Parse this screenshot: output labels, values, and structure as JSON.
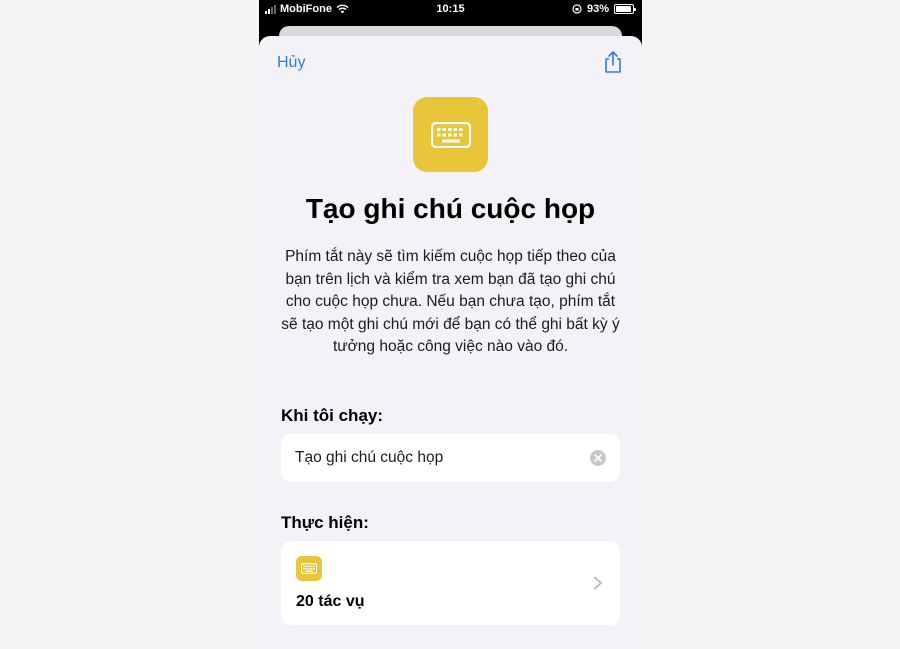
{
  "status_bar": {
    "carrier": "MobiFone",
    "time": "10:15",
    "battery": "93%",
    "battery_level": 0.93
  },
  "nav": {
    "cancel_label": "Hủy",
    "share_icon": "share-icon"
  },
  "shortcut": {
    "icon": "keyboard-icon",
    "icon_color": "#e9c53a",
    "title": "Tạo ghi chú cuộc họp",
    "description": "Phím tắt này sẽ tìm kiếm cuộc họp tiếp theo của bạn trên lịch và kiểm tra xem bạn đã tạo ghi chú cho cuộc họp chưa. Nếu bạn chưa tạo, phím tắt sẽ tạo một ghi chú mới để bạn có thể ghi bất kỳ ý tưởng hoặc công việc nào vào đó."
  },
  "run_section": {
    "label": "Khi tôi chạy:",
    "name_value": "Tạo ghi chú cuộc họp"
  },
  "do_section": {
    "label": "Thực hiện:",
    "actions_count": "20 tác vụ"
  },
  "colors": {
    "accent": "#3478f6",
    "sheet_bg": "#f2f2f7"
  }
}
